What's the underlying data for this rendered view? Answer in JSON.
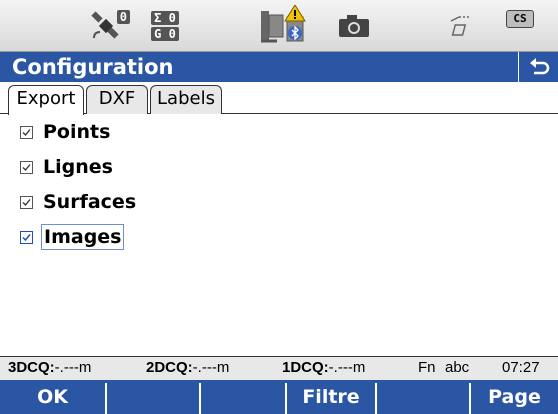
{
  "status_bar": {
    "satellite_icon": "satellite-icon",
    "satellite_count": "0",
    "sigma_count": "0",
    "g_count": "0",
    "sigma_label": "Σ",
    "g_label": "G",
    "instrument_icon": "instrument-warning-icon",
    "bluetooth_icon": "bluetooth-icon",
    "camera_icon": "camera-icon",
    "polyline_icon": "polyline-icon",
    "cs_label": "CS"
  },
  "title_bar": {
    "title": "Configuration",
    "back_icon": "back-arrow-icon",
    "color": "#2a56a3"
  },
  "tabs": [
    {
      "label": "Export",
      "active": true
    },
    {
      "label": "DXF",
      "active": false
    },
    {
      "label": "Labels",
      "active": false
    }
  ],
  "options": [
    {
      "label": "Points",
      "checked": true,
      "focused": false
    },
    {
      "label": "Lignes",
      "checked": true,
      "focused": false
    },
    {
      "label": "Surfaces",
      "checked": true,
      "focused": false
    },
    {
      "label": "Images",
      "checked": true,
      "focused": true
    }
  ],
  "info_bar": {
    "cq3d_label": "3DCQ:",
    "cq3d_value": "-.---m",
    "cq2d_label": "2DCQ:",
    "cq2d_value": "-.---m",
    "cq1d_label": "1DCQ:",
    "cq1d_value": "-.---m",
    "fn_label": "Fn",
    "input_mode": "abc",
    "time": "07:27"
  },
  "softkeys": [
    "OK",
    "",
    "",
    "Filtre",
    "",
    "Page"
  ]
}
